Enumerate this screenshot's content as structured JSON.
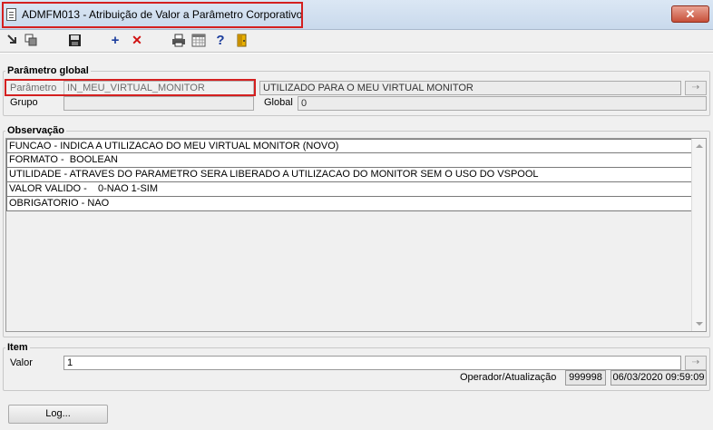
{
  "window": {
    "title": "ADMFM013 - Atribuição de Valor a Parâmetro Corporativo",
    "close_label": "✕"
  },
  "toolbar": {
    "icons": [
      "exit-icon",
      "copy-icon",
      "save-icon",
      "add-icon",
      "delete-icon",
      "print-icon",
      "calendar-icon",
      "help-icon",
      "door-exit-icon"
    ]
  },
  "parametro_global": {
    "legend": "Parâmetro global",
    "parametro_label": "Parâmetro",
    "parametro_value": "IN_MEU_VIRTUAL_MONITOR",
    "descricao_value": "UTILIZADO PARA O MEU VIRTUAL MONITOR",
    "grupo_label": "Grupo",
    "grupo_value": "",
    "global_label": "Global",
    "global_value": "0"
  },
  "observacao": {
    "legend": "Observação",
    "lines": [
      "FUNCAO - INDICA A UTILIZACAO DO MEU VIRTUAL MONITOR (NOVO)",
      "FORMATO -  BOOLEAN",
      "UTILIDADE - ATRAVES DO PARAMETRO SERA LIBERADO A UTILIZACAO DO MONITOR SEM O USO DO VSPOOL",
      "VALOR VALIDO -    0-NAO 1-SIM",
      "OBRIGATORIO - NAO"
    ]
  },
  "item": {
    "legend": "Item",
    "valor_label": "Valor",
    "valor_value": "1",
    "operador_label": "Operador/Atualização",
    "operador_value": "999998",
    "atualizacao_value": "06/03/2020 09:59:09"
  },
  "log_button": "Log...",
  "colors": {
    "highlight": "#d42020",
    "accent_blue": "#1a3c9c",
    "delete_red": "#d01010"
  }
}
